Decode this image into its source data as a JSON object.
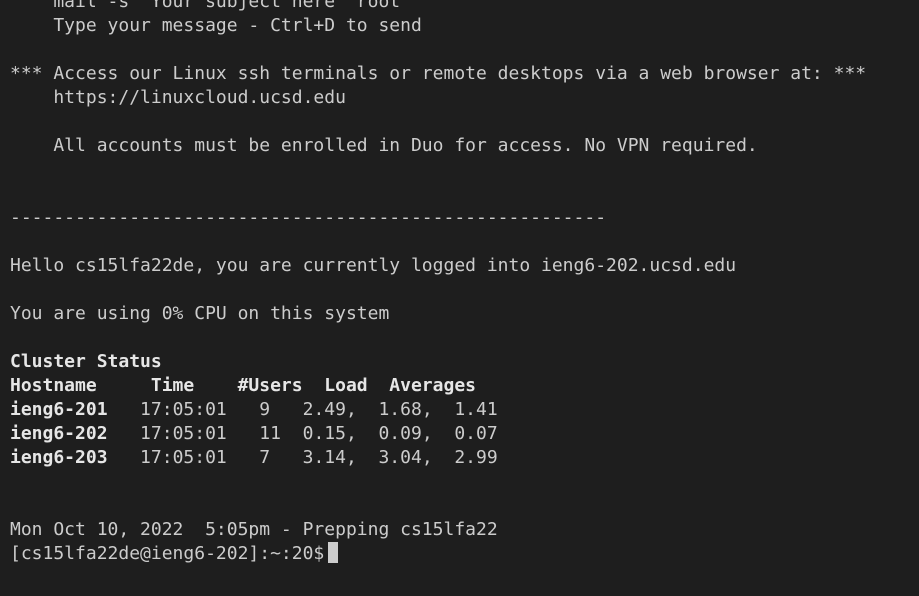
{
  "terminal": {
    "mail_line": "    mail -s \"Your subject here\" root",
    "type_message_line": "    Type your message - Ctrl+D to send",
    "access_line": "*** Access our Linux ssh terminals or remote desktops via a web browser at: ***",
    "url_line": "    https://linuxcloud.ucsd.edu",
    "duo_line": "    All accounts must be enrolled in Duo for access. No VPN required.",
    "separator_line": "-------------------------------------------------------",
    "hello_line": "Hello cs15lfa22de, you are currently logged into ieng6-202.ucsd.edu",
    "cpu_line": "You are using 0% CPU on this system",
    "cluster_title": "Cluster Status",
    "cluster_header": "Hostname     Time    #Users  Load  Averages",
    "cluster_rows": [
      "ieng6-201   17:05:01   9   2.49,  1.68,  1.41",
      "ieng6-202   17:05:01   11  0.15,  0.09,  0.07",
      "ieng6-203   17:05:01   7   3.14,  3.04,  2.99"
    ],
    "date_line": "Mon Oct 10, 2022  5:05pm - Prepping cs15lfa22",
    "prompt": "[cs15lfa22de@ieng6-202]:~:20$"
  }
}
